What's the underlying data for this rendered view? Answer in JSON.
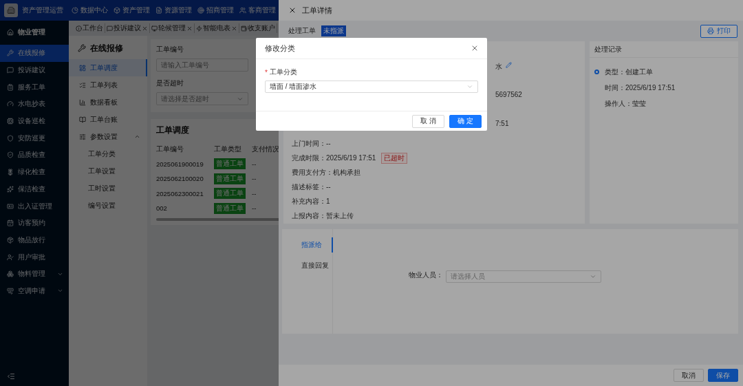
{
  "top_bar": {
    "app_name": "资产管理运营",
    "nav": [
      "数据中心",
      "资产管理",
      "资源管理",
      "招商管理",
      "客商管理"
    ]
  },
  "sidebar": {
    "group": "物业管理",
    "items": [
      {
        "label": "在线报修",
        "selected": true
      },
      {
        "label": "投诉建议",
        "selected": false
      },
      {
        "label": "服务工单",
        "selected": false
      },
      {
        "label": "水电抄表",
        "selected": false
      },
      {
        "label": "设备巡检",
        "selected": false
      },
      {
        "label": "安防巡更",
        "selected": false
      },
      {
        "label": "品质检查",
        "selected": false
      },
      {
        "label": "绿化检查",
        "selected": false
      },
      {
        "label": "保洁检查",
        "selected": false
      },
      {
        "label": "出入证管理",
        "selected": false
      },
      {
        "label": "访客预约",
        "selected": false
      },
      {
        "label": "物品放行",
        "selected": false
      },
      {
        "label": "用户审批",
        "selected": false
      },
      {
        "label": "物料管理",
        "selected": false,
        "expandable": true
      },
      {
        "label": "空调申请",
        "selected": false,
        "expandable": true
      }
    ]
  },
  "tabs": [
    {
      "label": "工作台",
      "closable": false
    },
    {
      "label": "投诉建议",
      "closable": true
    },
    {
      "label": "轮候管理",
      "closable": true
    },
    {
      "label": "智能电表",
      "closable": true
    },
    {
      "label": "收支账户",
      "closable": false
    }
  ],
  "submenu": {
    "title": "在线报修",
    "items": [
      {
        "label": "工单调度",
        "selected": true
      },
      {
        "label": "工单列表",
        "selected": false
      },
      {
        "label": "数据看板",
        "selected": false
      },
      {
        "label": "工单台账",
        "selected": false
      },
      {
        "label": "参数设置",
        "selected": false,
        "expanded": true,
        "children": [
          {
            "label": "工单分类",
            "selected": false
          },
          {
            "label": "工单设置",
            "selected": false
          },
          {
            "label": "工时设置",
            "selected": false
          },
          {
            "label": "编号设置",
            "selected": false
          }
        ]
      }
    ]
  },
  "filters": [
    {
      "label": "工单编号",
      "placeholder": "请输入工单编号",
      "kind": "input"
    },
    {
      "label": "是否超时",
      "placeholder": "请选择是否超时",
      "kind": "select"
    }
  ],
  "table": {
    "title": "工单调度",
    "columns": [
      "工单编号",
      "工单类型",
      "支付情况"
    ],
    "rows": [
      {
        "id": "2025061900019",
        "type": "普通工单",
        "payment": "--"
      },
      {
        "id": "2025062100020",
        "type": "普通工单",
        "payment": "--"
      },
      {
        "id": "2025062300021",
        "type": "普通工单",
        "payment": "--"
      },
      {
        "id": "002",
        "type": "普通工单",
        "payment": "--"
      }
    ]
  },
  "drawer": {
    "title": "工单详情",
    "status_label": "处理工单",
    "status_tag": "未指派",
    "print_button": "打印",
    "fragments": [
      {
        "text": "水",
        "editable": true
      },
      {
        "text": "5697562",
        "editable": false
      },
      {
        "text": "7:51",
        "editable": false
      }
    ],
    "details": [
      {
        "label": "上门时间：",
        "value": "--"
      },
      {
        "label": "完成时限：",
        "value": "2025/6/19 17:51",
        "tag": "已超时"
      },
      {
        "label": "费用支付方：",
        "value": "机构承担"
      },
      {
        "label": "描述标签：",
        "value": "--"
      },
      {
        "label": "补充内容：",
        "value": "1"
      },
      {
        "label": "上报内容：",
        "value": "暂未上传"
      }
    ],
    "log": {
      "title": "处理记录",
      "entries": [
        {
          "lines": [
            "类型：创建工单",
            "时间：2025/6/19 17:51",
            "操作人：莹莹"
          ]
        }
      ]
    },
    "assign_tabs": [
      {
        "label": "指派给",
        "selected": true
      },
      {
        "label": "直接回复",
        "selected": false
      }
    ],
    "assign_field": {
      "label": "物业人员：",
      "placeholder": "请选择人员"
    },
    "buttons": [
      {
        "label": "取消",
        "kind": "default"
      },
      {
        "label": "保存",
        "kind": "primary"
      }
    ]
  },
  "modal": {
    "title": "修改分类",
    "field": {
      "required_mark": "*",
      "label": "工单分类",
      "value": "墙面 / 墙面渗水"
    },
    "buttons": [
      {
        "label": "取 消",
        "kind": "default"
      },
      {
        "label": "确 定",
        "kind": "primary"
      }
    ]
  }
}
